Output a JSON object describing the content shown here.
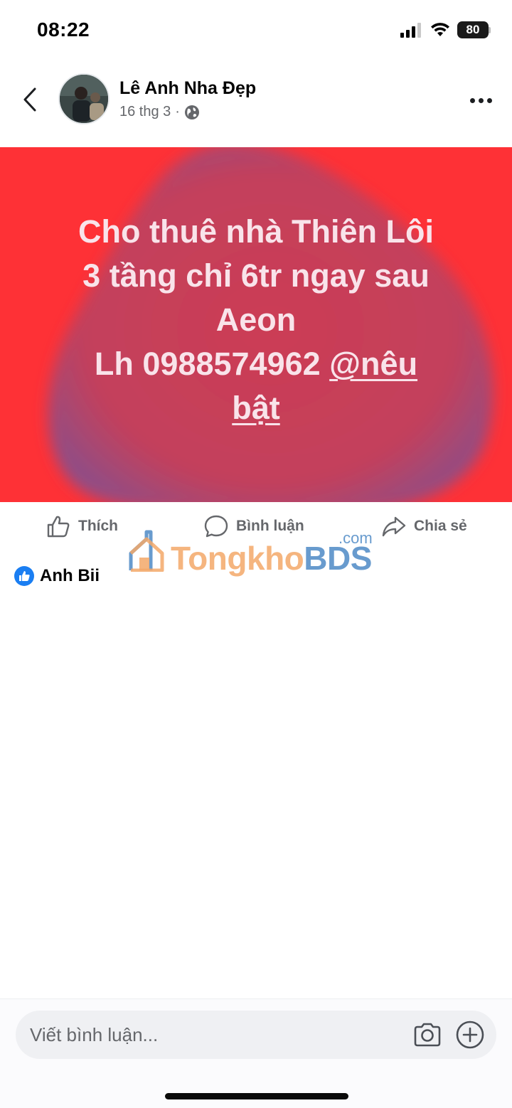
{
  "status_bar": {
    "time": "08:22",
    "battery": "80",
    "icons": [
      "signal-icon",
      "wifi-icon",
      "battery-icon"
    ]
  },
  "post": {
    "author": "Lê Anh Nha Đẹp",
    "date": "16 thg 3",
    "separator": "·",
    "privacy_icon": "globe-icon",
    "image": {
      "background_color": "#fe3136",
      "text_lines": [
        "Cho thuê nhà Thiên Lôi",
        "3 tầng chỉ 6tr  ngay sau",
        "Aeon"
      ],
      "contact_prefix": "Lh 0988574962 ",
      "mention_part1": "@nêu",
      "mention_part2": "bật"
    }
  },
  "actions": {
    "like_label": "Thích",
    "comment_label": "Bình luận",
    "share_label": "Chia sẻ"
  },
  "watermark": {
    "part1": "Tongkho",
    "part2": "BDS",
    "domain": ".com"
  },
  "reactions": {
    "icon": "like-icon",
    "name": "Anh Bii"
  },
  "comment_bar": {
    "placeholder": "Viết bình luận...",
    "icons": [
      "camera-icon",
      "plus-icon"
    ]
  },
  "colors": {
    "image_bg": "#fe3136",
    "blob": "#c2405c",
    "like_blue": "#1a7ef2",
    "secondary_text": "#65676b"
  }
}
